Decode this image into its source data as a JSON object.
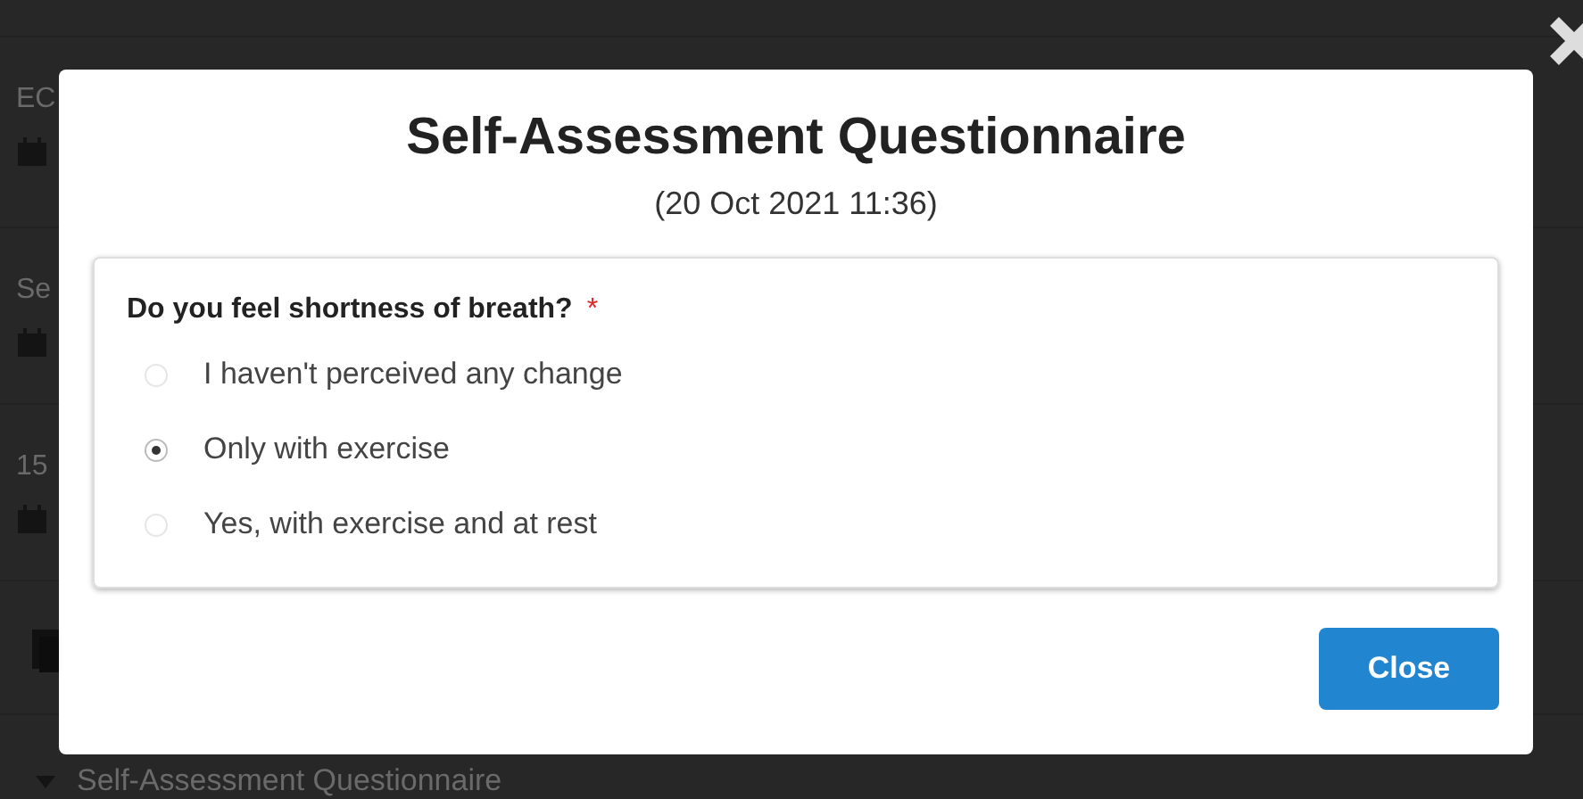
{
  "background": {
    "items": [
      {
        "label": "EC"
      },
      {
        "label": "Se"
      },
      {
        "label": "15"
      }
    ],
    "section_title": "Self-Assessment Questionnaire"
  },
  "dialog": {
    "title": "Self-Assessment Questionnaire",
    "subtitle": "(20 Oct 2021 11:36)",
    "question": {
      "text": "Do you feel shortness of breath?",
      "required": true,
      "required_mark": "*",
      "options": [
        {
          "label": "I haven't perceived any change",
          "selected": false
        },
        {
          "label": "Only with exercise",
          "selected": true
        },
        {
          "label": "Yes, with exercise and at rest",
          "selected": false
        }
      ]
    },
    "close_button": "Close"
  }
}
